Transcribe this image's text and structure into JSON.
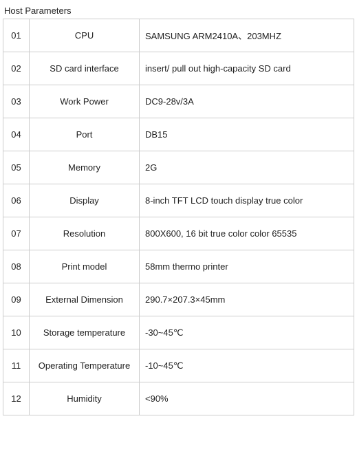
{
  "section": {
    "title": "Host Parameters"
  },
  "rows": [
    {
      "num": "01",
      "label": "CPU",
      "value": "SAMSUNG ARM2410A、203MHZ"
    },
    {
      "num": "02",
      "label": "SD card interface",
      "value": "insert/ pull out high-capacity SD card"
    },
    {
      "num": "03",
      "label": "Work Power",
      "value": "DC9-28v/3A"
    },
    {
      "num": "04",
      "label": "Port",
      "value": "DB15"
    },
    {
      "num": "05",
      "label": "Memory",
      "value": "2G"
    },
    {
      "num": "06",
      "label": "Display",
      "value": "8-inch TFT   LCD touch display true color"
    },
    {
      "num": "07",
      "label": "Resolution",
      "value": "800X600, 16 bit true color  color 65535"
    },
    {
      "num": "08",
      "label": "Print model",
      "value": "58mm thermo printer"
    },
    {
      "num": "09",
      "label": "External Dimension",
      "value": "290.7×207.3×45mm"
    },
    {
      "num": "10",
      "label": "Storage temperature",
      "value": "-30~45℃"
    },
    {
      "num": "11",
      "label": "Operating Temperature",
      "value": "-10~45℃"
    },
    {
      "num": "12",
      "label": "Humidity",
      "value": "<90%"
    }
  ]
}
